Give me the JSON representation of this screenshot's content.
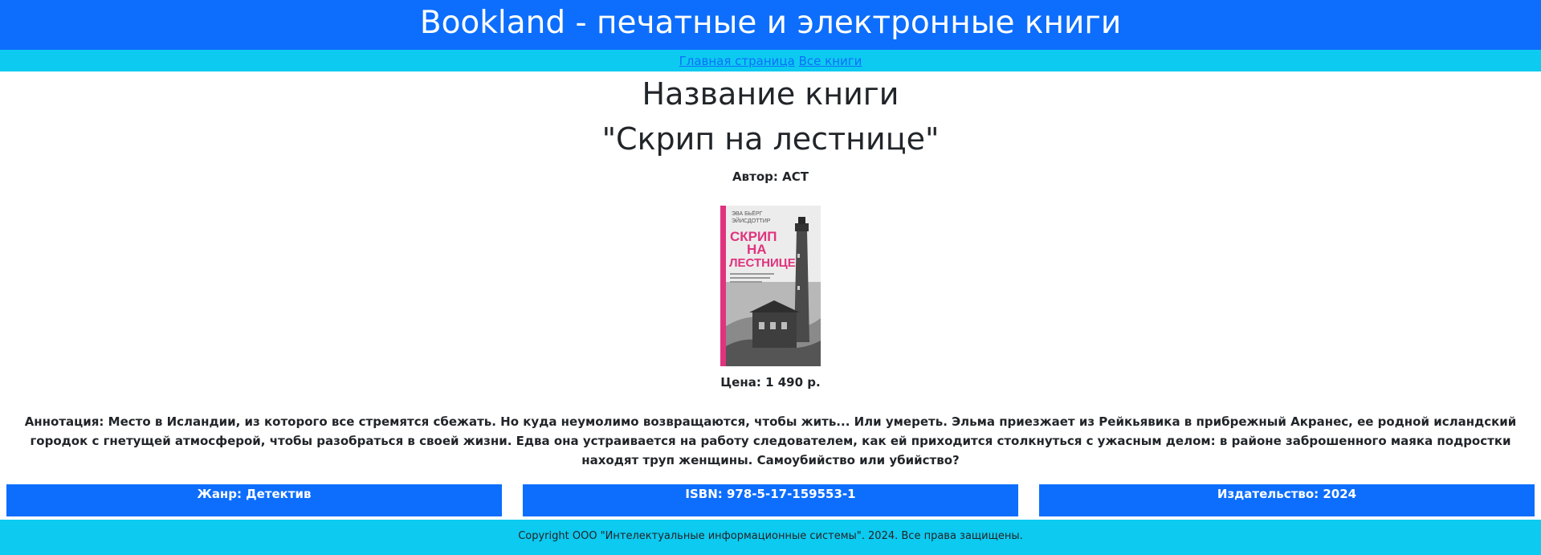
{
  "header": {
    "title": "Bookland - печатные и электронные книги"
  },
  "nav": {
    "links": [
      "Главная страница",
      "Все книги"
    ]
  },
  "book": {
    "title_label": "Название книги",
    "title": "\"Скрип на лестнице\"",
    "author_prefix": "Автор:",
    "author": "АСТ",
    "price_prefix": "Цена:",
    "price": "1 490 р.",
    "annotation_prefix": "Аннотация:",
    "annotation": "Место в Исландии, из которого все стремятся сбежать. Но куда неумолимо возвращаются, чтобы жить... Или умереть. Эльма приезжает из Рейкьявика в прибрежный Акранес, ее родной исландский городок с гнетущей атмосферой, чтобы разобраться в своей жизни. Едва она устраивается на работу следователем, как ей приходится столкнуться с ужасным делом: в районе заброшенного маяка подростки находят труп женщины. Самоубийство или убийство?",
    "genre_label": "Жанр: Детектив",
    "isbn_label": "ISBN: 978-5-17-159553-1",
    "publisher_label": "Издательство: 2024"
  },
  "cover": {
    "author_line1": "ЭВА БЬЁРГ",
    "author_line2": "ЭЙИСДОТТИР",
    "title_line1": "СКРИП",
    "title_line2": "НА",
    "title_line3": "ЛЕСТНИЦЕ",
    "accent_color": "#e0337e"
  },
  "footer": {
    "text": "Copyright ООО \"Интелектуальные информационные системы\". 2024. Все права защищены."
  },
  "colors": {
    "primary": "#0d6efd",
    "info": "#0dcaf0"
  }
}
